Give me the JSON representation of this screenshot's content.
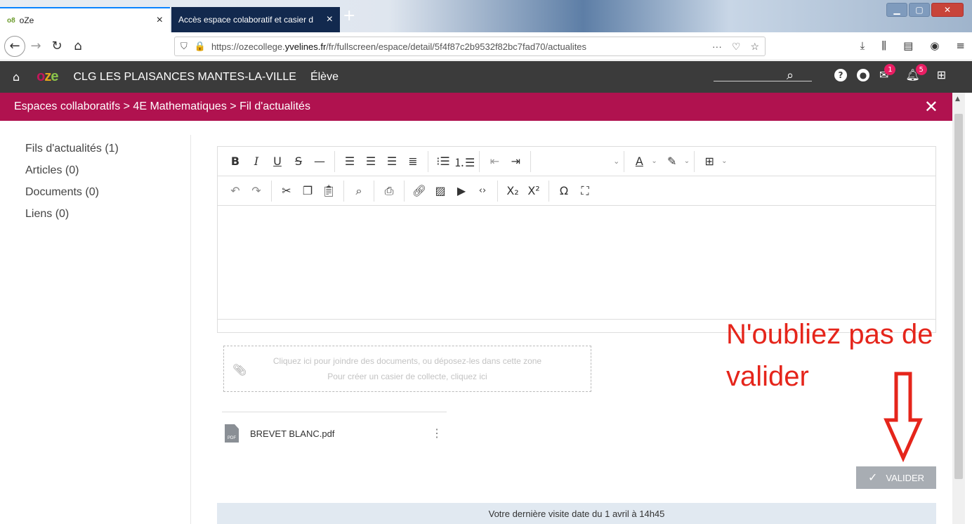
{
  "browser": {
    "tabs": [
      {
        "label": "oZe",
        "logo": "o8"
      },
      {
        "label": "Accès espace colaboratif et casier d"
      }
    ],
    "new_tab_glyph": "+",
    "close_glyph": "×",
    "url_prefix": "https://ozecollege.",
    "url_domain": "yvelines.fr",
    "url_path": "/fr/fullscreen/espace/detail/5f4f87c2b9532f82bc7fad70/actualites",
    "url_more": "···"
  },
  "app": {
    "logo": {
      "o": "o",
      "z": "z",
      "e": "e"
    },
    "school": "CLG LES PLAISANCES MANTES-LA-VILLE",
    "role": "Élève",
    "mail_badge": "1",
    "notif_badge": "5"
  },
  "breadcrumb": "Espaces collaboratifs > 4E Mathematiques > Fil d'actualités",
  "sidebar": {
    "items": [
      {
        "label": "Fils d'actualités (1)"
      },
      {
        "label": "Articles (0)"
      },
      {
        "label": "Documents (0)"
      },
      {
        "label": "Liens (0)"
      }
    ]
  },
  "dropzone": {
    "line1": "Cliquez ici pour joindre des documents, ou déposez-les dans cette zone",
    "line2": "Pour créer un casier de collecte, cliquez ici"
  },
  "file": {
    "name": "BREVET BLANC.pdf",
    "icon_text": "PDF"
  },
  "annotation": {
    "line1": "N'oubliez pas de",
    "line2": "valider",
    "color": "#e5251b"
  },
  "valider_button": {
    "label": "VALIDER"
  },
  "last_visit": "Votre dernière visite date du 1 avril à 14h45",
  "colors": {
    "appbar": "#3b3b3b",
    "breadcrumb": "#b0124f",
    "badge": "#e91e63"
  }
}
